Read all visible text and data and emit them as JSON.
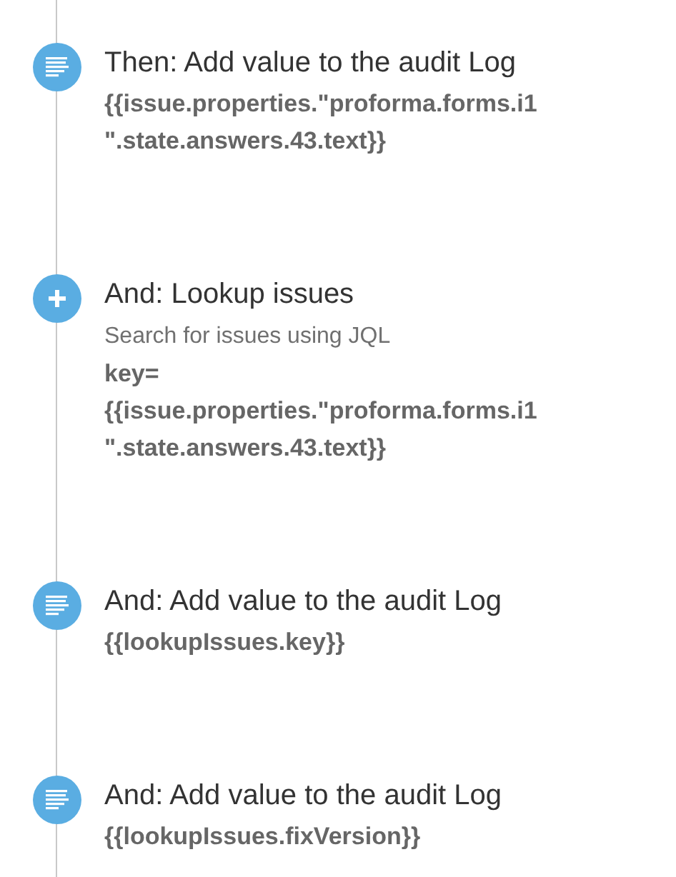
{
  "steps": [
    {
      "kind": "log",
      "title": "Then: Add value to the audit Log",
      "code_lines": [
        "{{issue.properties.\"proforma.forms.i1",
        "\".state.answers.43.text}}"
      ]
    },
    {
      "kind": "add",
      "title": "And: Lookup issues",
      "description": "Search for issues using JQL",
      "code_lines": [
        "key=",
        "{{issue.properties.\"proforma.forms.i1",
        "\".state.answers.43.text}}"
      ]
    },
    {
      "kind": "log",
      "title": "And: Add value to the audit Log",
      "code_lines": [
        "{{lookupIssues.key}}"
      ]
    },
    {
      "kind": "log",
      "title": "And: Add value to the audit Log",
      "code_lines": [
        "{{lookupIssues.fixVersion}}"
      ]
    }
  ]
}
